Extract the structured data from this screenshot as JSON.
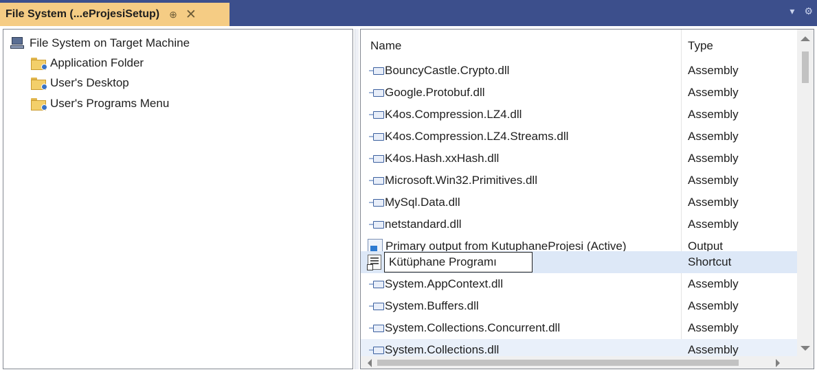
{
  "window": {
    "tab_title": "File System (...eProjesiSetup)",
    "pin_glyph": "⊕",
    "close_glyph": "✕",
    "dropdown_glyph": "▾",
    "settings_glyph": "⚙"
  },
  "tree": {
    "root": {
      "label": "File System on Target Machine",
      "icon": "computer-icon"
    },
    "items": [
      {
        "label": "Application Folder",
        "icon": "folder-icon"
      },
      {
        "label": "User's Desktop",
        "icon": "folder-icon"
      },
      {
        "label": "User's Programs Menu",
        "icon": "folder-icon"
      }
    ]
  },
  "list": {
    "columns": {
      "name": "Name",
      "type": "Type"
    },
    "rows": [
      {
        "name": "BouncyCastle.Crypto.dll",
        "type": "Assembly",
        "icon": "assembly-icon"
      },
      {
        "name": "Google.Protobuf.dll",
        "type": "Assembly",
        "icon": "assembly-icon"
      },
      {
        "name": "K4os.Compression.LZ4.dll",
        "type": "Assembly",
        "icon": "assembly-icon"
      },
      {
        "name": "K4os.Compression.LZ4.Streams.dll",
        "type": "Assembly",
        "icon": "assembly-icon"
      },
      {
        "name": "K4os.Hash.xxHash.dll",
        "type": "Assembly",
        "icon": "assembly-icon"
      },
      {
        "name": "Microsoft.Win32.Primitives.dll",
        "type": "Assembly",
        "icon": "assembly-icon"
      },
      {
        "name": "MySql.Data.dll",
        "type": "Assembly",
        "icon": "assembly-icon"
      },
      {
        "name": "netstandard.dll",
        "type": "Assembly",
        "icon": "assembly-icon"
      },
      {
        "name": "Primary output from KutuphaneProjesi (Active)",
        "type": "Output",
        "icon": "project-output-icon"
      },
      {
        "name": "Kütüphane Programı",
        "type": "Shortcut",
        "icon": "shortcut-icon",
        "editing": true
      },
      {
        "name": "System.AppContext.dll",
        "type": "Assembly",
        "icon": "assembly-icon"
      },
      {
        "name": "System.Buffers.dll",
        "type": "Assembly",
        "icon": "assembly-icon"
      },
      {
        "name": "System.Collections.Concurrent.dll",
        "type": "Assembly",
        "icon": "assembly-icon"
      },
      {
        "name": "System.Collections.dll",
        "type": "Assembly",
        "icon": "assembly-icon"
      }
    ]
  }
}
